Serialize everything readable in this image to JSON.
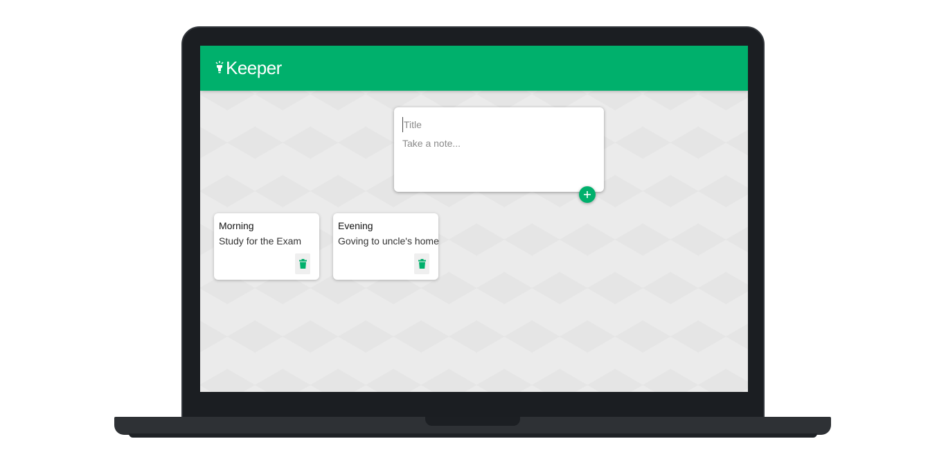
{
  "app": {
    "name": "Keeper",
    "accent_color": "#00b06c",
    "logo_icon": "lightbulb-icon"
  },
  "create_note": {
    "title_placeholder": "Title",
    "title_value": "",
    "content_placeholder": "Take a note...",
    "content_value": "",
    "add_icon": "plus-icon"
  },
  "notes": [
    {
      "title": "Morning",
      "content": "Study for the Exam",
      "delete_icon": "trash-icon"
    },
    {
      "title": "Evening",
      "content": "Goving to uncle's home",
      "delete_icon": "trash-icon"
    }
  ]
}
